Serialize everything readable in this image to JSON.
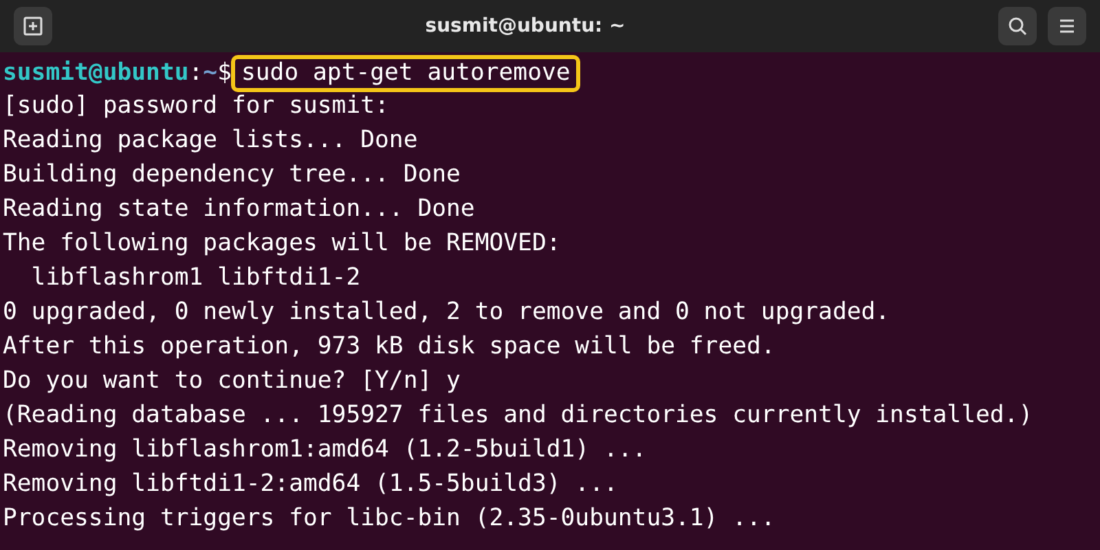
{
  "window": {
    "title": "susmit@ubuntu: ~"
  },
  "prompt": {
    "user_host": "susmit@ubuntu",
    "separator": ":",
    "path": "~",
    "symbol": "$"
  },
  "command": {
    "text": "sudo apt-get autoremove",
    "highlighted": true
  },
  "output": [
    "[sudo] password for susmit:",
    "Reading package lists... Done",
    "Building dependency tree... Done",
    "Reading state information... Done",
    "The following packages will be REMOVED:",
    "  libflashrom1 libftdi1-2",
    "0 upgraded, 0 newly installed, 2 to remove and 0 not upgraded.",
    "After this operation, 973 kB disk space will be freed.",
    "Do you want to continue? [Y/n] y",
    "(Reading database ... 195927 files and directories currently installed.)",
    "Removing libflashrom1:amd64 (1.2-5build1) ...",
    "Removing libftdi1-2:amd64 (1.5-5build3) ...",
    "Processing triggers for libc-bin (2.35-0ubuntu3.1) ..."
  ]
}
